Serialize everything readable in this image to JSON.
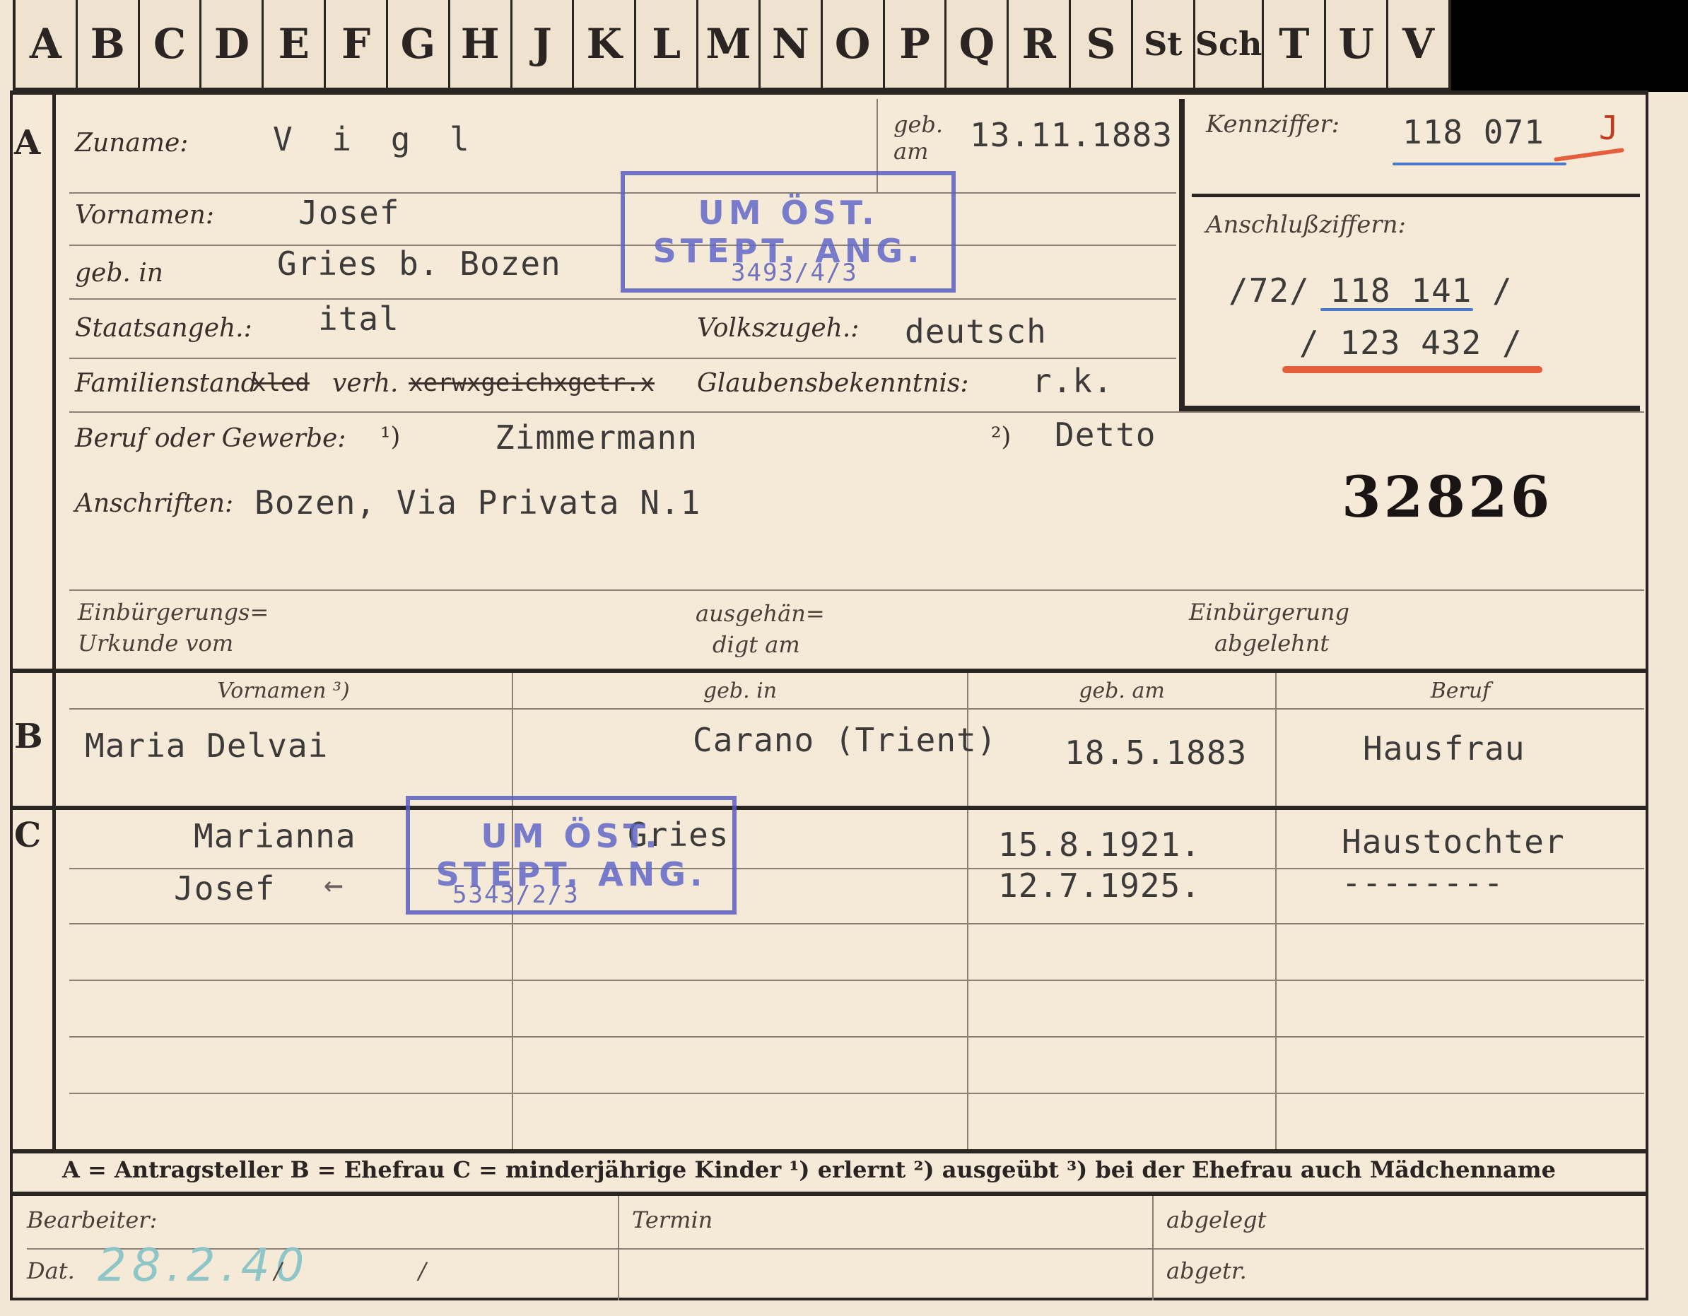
{
  "tabs": [
    "A",
    "B",
    "C",
    "D",
    "E",
    "F",
    "G",
    "H",
    "J",
    "K",
    "L",
    "M",
    "N",
    "O",
    "P",
    "Q",
    "R",
    "S",
    "St",
    "Sch",
    "T",
    "U",
    "V"
  ],
  "sections": {
    "a": "A",
    "b": "B",
    "c": "C"
  },
  "person": {
    "surname_label": "Zuname:",
    "surname": "V i g l",
    "born_on_label_1": "geb.",
    "born_on_label_2": "am",
    "born_on": "13.11.1883",
    "first_names_label": "Vornamen:",
    "first_names": "Josef",
    "born_in_label": "geb. in",
    "born_in": "Gries b. Bozen",
    "citizenship_label": "Staatsangeh.:",
    "citizenship": "ital",
    "ethnicity_label": "Volkszugeh.:",
    "ethnicity": "deutsch",
    "marital_label": "Familienstand",
    "marital_struck_1": "xled",
    "marital_value": "verh.",
    "marital_struck_2": "xerwxgeichxgetr.x",
    "religion_label": "Glaubensbekenntnis:",
    "religion": "r.k.",
    "occupation_label": "Beruf oder Gewerbe:",
    "occupation_mark_1": "¹)",
    "occupation": "Zimmermann",
    "occupation_mark_2": "²)",
    "occupation_2": "Detto",
    "address_label": "Anschriften:",
    "address": "Bozen, Via Privata N.1",
    "naturalization_label_1": "Einbürgerungs=",
    "naturalization_label_2": "Urkunde vom",
    "handed_label_1": "ausgehän=",
    "handed_label_2": "digt am",
    "rejected_label_1": "Einbürgerung",
    "rejected_label_2": "abgelehnt"
  },
  "id_box": {
    "label": "Kennziffer:",
    "number": "118 071",
    "suffix": "J",
    "connect_label": "Anschlußziffern:",
    "connect_1": "/72/ 118 141 /",
    "connect_2": "/ 123 432 /"
  },
  "big_number": "32826",
  "stamp_1": {
    "line1": "UM ÖST.",
    "line2": "STEPT. ANG.",
    "num": "3493/4/3"
  },
  "stamp_2": {
    "line1": "UM ÖST.",
    "line2": "STEPT. ANG.",
    "num": "5343/2/3"
  },
  "spouse": {
    "headers": [
      "Vornamen ³)",
      "geb. in",
      "geb. am",
      "Beruf"
    ],
    "name": "Maria Delvai",
    "born_in": "Carano (Trient)",
    "born_on": "18.5.1883",
    "occupation": "Hausfrau"
  },
  "children": [
    {
      "name": "Marianna",
      "born_in": "Gries",
      "born_on": "15.8.1921.",
      "occupation": "Haustochter"
    },
    {
      "name": "Josef",
      "arrow": "←",
      "born_in": "",
      "born_on": "12.7.1925.",
      "occupation": "--------"
    }
  ],
  "legend": "A = Antragsteller   B = Ehefrau   C = minderjährige Kinder   ¹) erlernt   ²) ausgeübt   ³) bei der Ehefrau auch Mädchenname",
  "footer": {
    "processor_label": "Bearbeiter:",
    "date_label": "Dat.",
    "date_value": "28.2.40",
    "slash_1": "/",
    "slash_2": "/",
    "deadline_label": "Termin",
    "filed_label": "abgelegt",
    "transferred_label": "abgetr."
  },
  "colors": {
    "stamp": "#5a5fc0",
    "ink_red": "#e4502c",
    "ink_blue": "#4a7ac8",
    "pencil": "#8ec6c8"
  }
}
